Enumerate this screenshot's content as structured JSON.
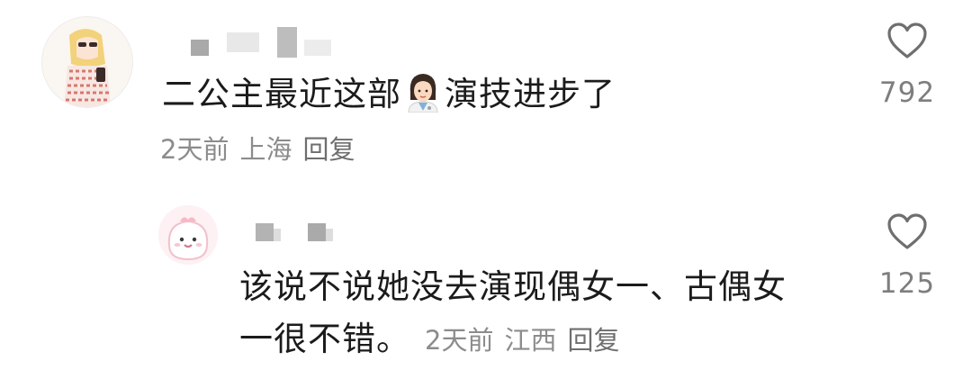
{
  "comments": [
    {
      "text_before_emoji": "二公主最近这部",
      "text_after_emoji": "演技进步了",
      "emoji": "woman-health-worker-emoji",
      "time": "2天前",
      "location": "上海",
      "reply_label": "回复",
      "likes": "792"
    },
    {
      "text_line1": "该说不说她没去演现偶女一、古偶女",
      "text_line2": "一很不错。",
      "time": "2天前",
      "location": "江西",
      "reply_label": "回复",
      "likes": "125"
    }
  ],
  "colors": {
    "text": "#1b1b1b",
    "meta": "#8c8c8c",
    "icon": "#6f6f6f"
  }
}
